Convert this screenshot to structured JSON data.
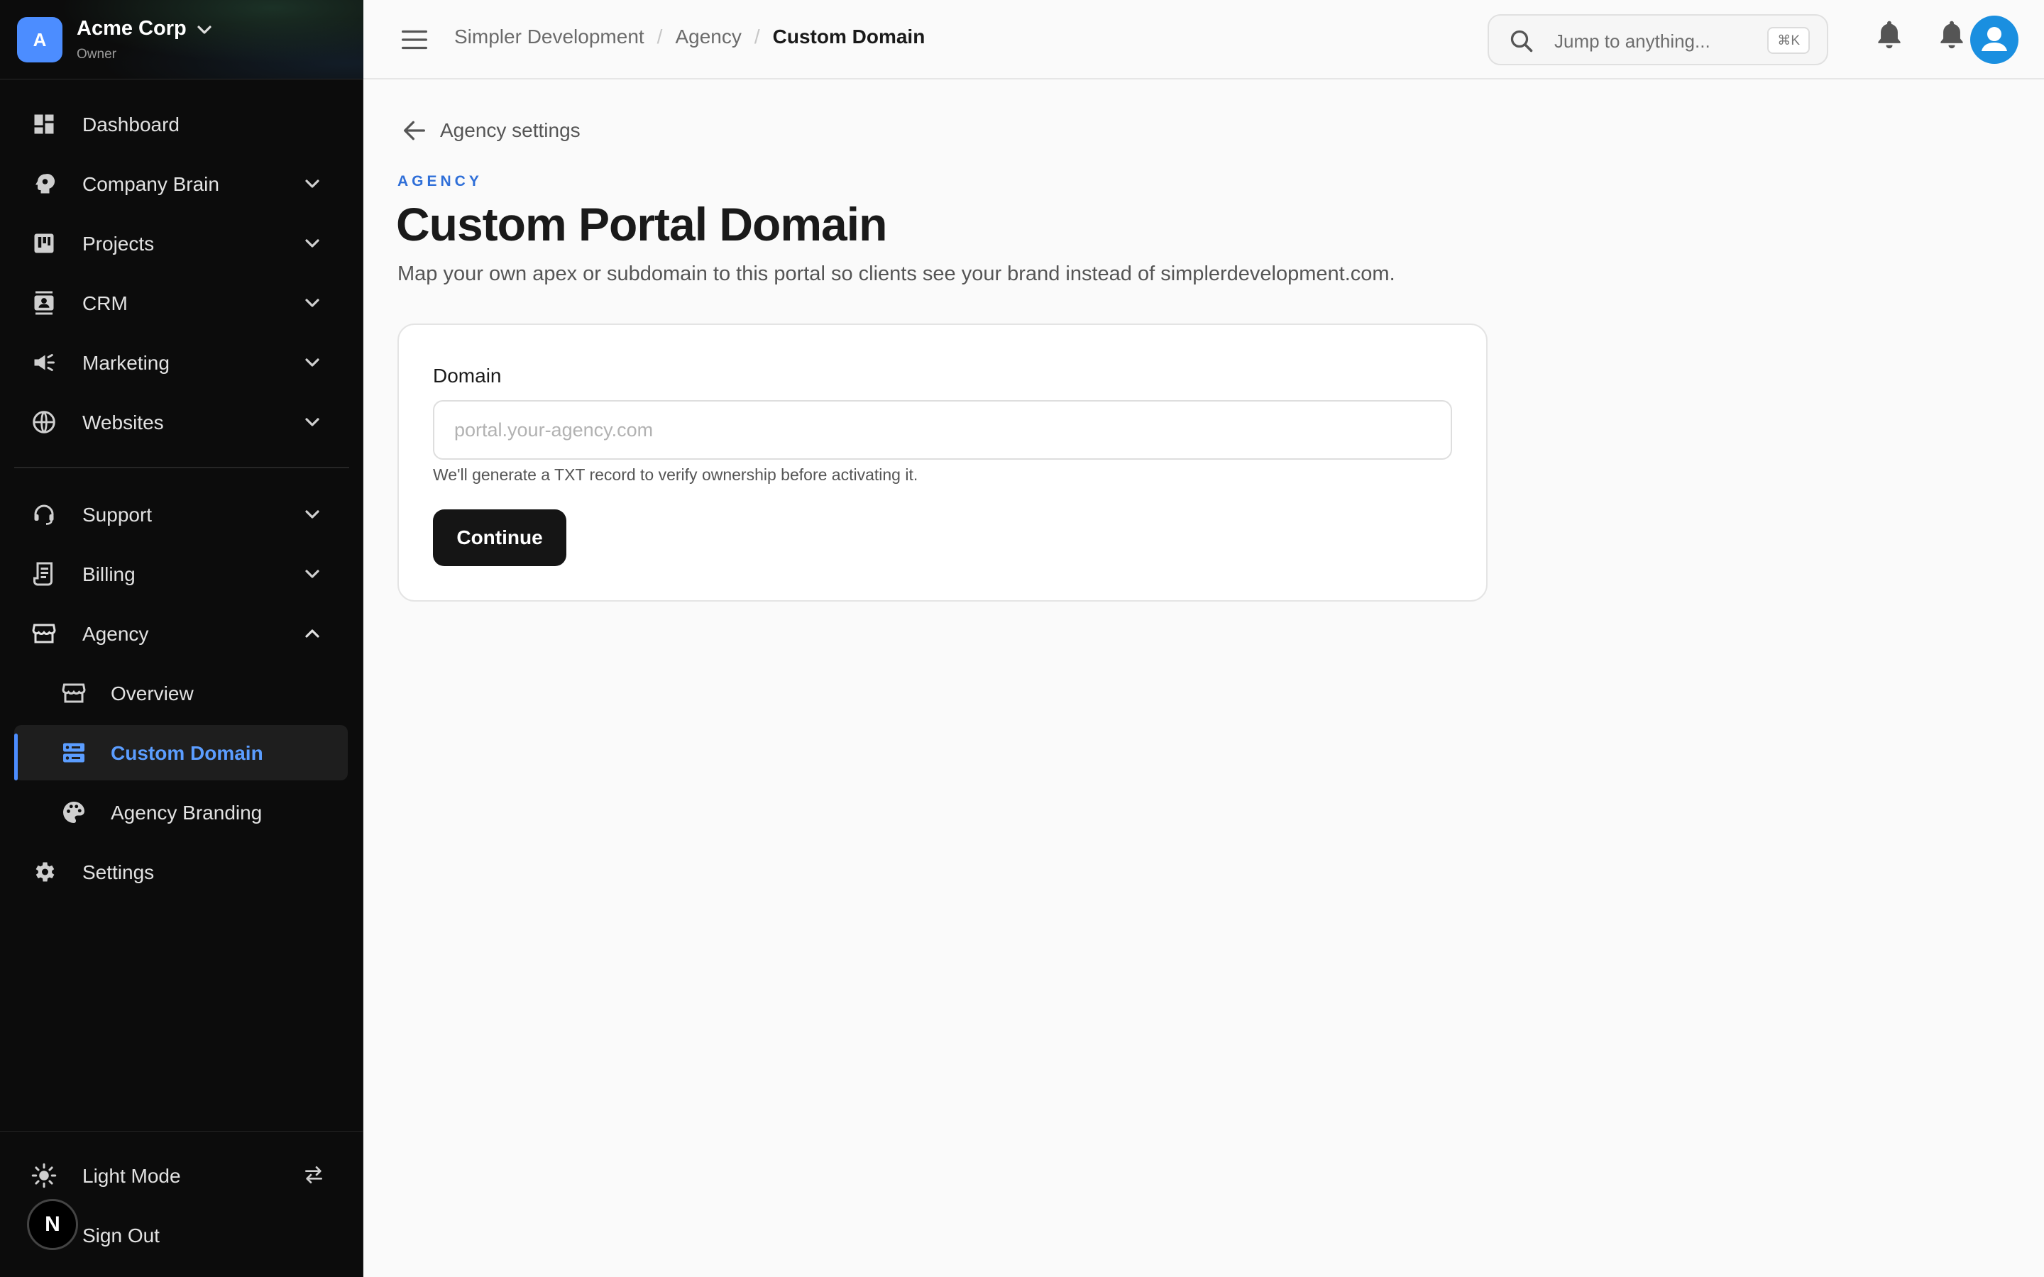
{
  "org": {
    "initial": "A",
    "name": "Acme Corp",
    "role": "Owner"
  },
  "sidebar": {
    "items": [
      {
        "label": "Dashboard",
        "icon": "dashboard-icon"
      },
      {
        "label": "Company Brain",
        "icon": "brain-icon"
      },
      {
        "label": "Projects",
        "icon": "kanban-icon"
      },
      {
        "label": "CRM",
        "icon": "contacts-icon"
      },
      {
        "label": "Marketing",
        "icon": "megaphone-icon"
      },
      {
        "label": "Websites",
        "icon": "globe-icon"
      },
      {
        "label": "Support",
        "icon": "headset-icon"
      },
      {
        "label": "Billing",
        "icon": "receipt-icon"
      },
      {
        "label": "Agency",
        "icon": "storefront-icon"
      },
      {
        "label": "Overview",
        "icon": "storefront-icon"
      },
      {
        "label": "Custom Domain",
        "icon": "server-icon"
      },
      {
        "label": "Agency Branding",
        "icon": "palette-icon"
      },
      {
        "label": "Settings",
        "icon": "gear-icon"
      }
    ],
    "active": "Custom Domain",
    "light_mode_label": "Light Mode",
    "sign_out_label": "Sign Out",
    "badge": "N"
  },
  "topbar": {
    "breadcrumbs": [
      "Simpler Development",
      "Agency",
      "Custom Domain"
    ],
    "separator": "/",
    "search_placeholder": "Jump to anything...",
    "search_shortcut": "⌘K"
  },
  "page": {
    "back_label": "Agency settings",
    "eyebrow": "AGENCY",
    "title": "Custom Portal Domain",
    "subtitle": "Map your own apex or subdomain to this portal so clients see your brand instead of simplerdevelopment.com.",
    "form": {
      "label": "Domain",
      "value": "",
      "placeholder": "portal.your-agency.com",
      "hint": "We'll generate a TXT record to verify ownership before activating it.",
      "submit_label": "Continue"
    }
  },
  "colors": {
    "accent": "#4c8dff",
    "eyebrow": "#2f6fd8",
    "sidebar_bg": "#0c0c0c",
    "button_bg": "#151515"
  }
}
